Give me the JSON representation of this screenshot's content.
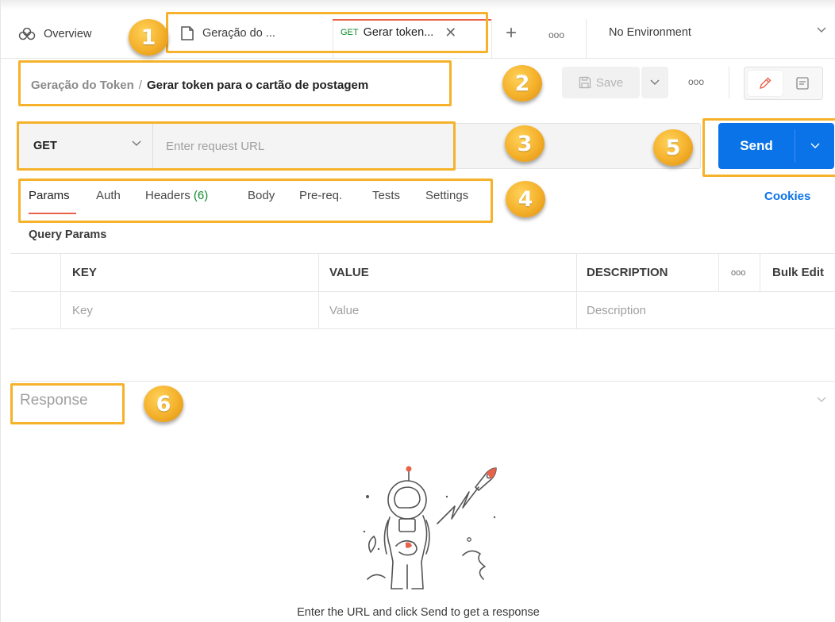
{
  "tabs": {
    "overview": "Overview",
    "doc_tab": "Geração do ...",
    "active_method": "GET",
    "active_title": "Gerar token...",
    "more": "ooo"
  },
  "environment": "No Environment",
  "breadcrumb": {
    "parent": "Geração do Token",
    "separator": "/",
    "current": "Gerar token para o cartão de postagem"
  },
  "toolbar": {
    "save_label": "Save",
    "more": "ooo"
  },
  "request": {
    "method": "GET",
    "url_placeholder": "Enter request URL",
    "send_label": "Send"
  },
  "request_tabs": {
    "params": "Params",
    "auth": "Auth",
    "headers": "Headers",
    "headers_count": "(6)",
    "body": "Body",
    "prereq": "Pre-req.",
    "tests": "Tests",
    "settings": "Settings"
  },
  "cookies": "Cookies",
  "query_params": {
    "title": "Query Params",
    "columns": {
      "key": "KEY",
      "value": "VALUE",
      "description": "DESCRIPTION",
      "more": "ooo",
      "bulk_edit": "Bulk Edit"
    },
    "placeholders": {
      "key": "Key",
      "value": "Value",
      "description": "Description"
    }
  },
  "response": {
    "title": "Response",
    "hint": "Enter the URL and click Send to get a response"
  },
  "annotations": [
    "1",
    "2",
    "3",
    "4",
    "5",
    "6"
  ],
  "colors": {
    "accent_blue": "#0a73e8",
    "tab_underline": "#e8624a",
    "highlight": "#f5b22a",
    "get_green": "#0c8a2a"
  }
}
